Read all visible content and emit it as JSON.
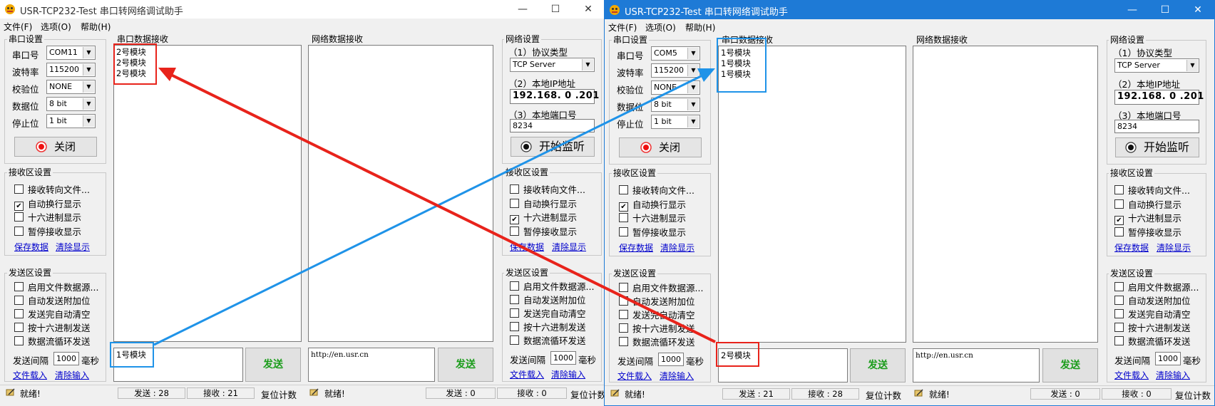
{
  "windows": [
    {
      "title": "USR-TCP232-Test 串口转网络调试助手",
      "menu": [
        "文件(F)",
        "选项(O)",
        "帮助(H)"
      ],
      "serial": {
        "legend": "串口设置",
        "port_label": "串口号",
        "port": "COM11",
        "baud_label": "波特率",
        "baud": "115200",
        "parity_label": "校验位",
        "parity": "NONE",
        "data_label": "数据位",
        "data": "8 bit",
        "stop_label": "停止位",
        "stop": "1 bit",
        "action": "关闭"
      },
      "recv_settings": {
        "legend": "接收区设置",
        "options": [
          {
            "label": "接收转向文件...",
            "checked": false
          },
          {
            "label": "自动换行显示",
            "checked": true
          },
          {
            "label": "十六进制显示",
            "checked": false
          },
          {
            "label": "暂停接收显示",
            "checked": false
          }
        ],
        "save": "保存数据",
        "clear": "清除显示"
      },
      "send_settings": {
        "legend": "发送区设置",
        "options": [
          {
            "label": "启用文件数据源...",
            "checked": false
          },
          {
            "label": "自动发送附加位",
            "checked": false
          },
          {
            "label": "发送完自动清空",
            "checked": false
          },
          {
            "label": "按十六进制发送",
            "checked": false
          },
          {
            "label": "数据流循环发送",
            "checked": false
          }
        ],
        "interval_label": "发送间隔",
        "interval": "1000",
        "interval_unit": "毫秒",
        "file_load": "文件载入",
        "clear_input": "清除输入"
      },
      "serial_recv": {
        "legend": "串口数据接收",
        "text": "2号模块\n2号模块\n2号模块"
      },
      "serial_send": {
        "text": "1号模块",
        "button": "发送"
      },
      "net_recv": {
        "legend": "网络数据接收",
        "text": ""
      },
      "net_send": {
        "text": "http://en.usr.cn",
        "button": "发送"
      },
      "net": {
        "legend": "网络设置",
        "proto_label": "（1）协议类型",
        "proto": "TCP Server",
        "ip_label": "（2）本地IP地址",
        "ip": "192.168. 0 .201",
        "port_label": "（3）本地端口号",
        "port": "8234",
        "action": "开始监听"
      },
      "net_recv_settings": {
        "legend": "接收区设置",
        "options": [
          {
            "label": "接收转向文件...",
            "checked": false
          },
          {
            "label": "自动换行显示",
            "checked": false
          },
          {
            "label": "十六进制显示",
            "checked": true
          },
          {
            "label": "暂停接收显示",
            "checked": false
          }
        ],
        "save": "保存数据",
        "clear": "清除显示"
      },
      "net_send_settings": {
        "legend": "发送区设置",
        "options": [
          {
            "label": "启用文件数据源...",
            "checked": false
          },
          {
            "label": "自动发送附加位",
            "checked": false
          },
          {
            "label": "发送完自动清空",
            "checked": false
          },
          {
            "label": "按十六进制发送",
            "checked": false
          },
          {
            "label": "数据流循环发送",
            "checked": false
          }
        ],
        "interval_label": "发送间隔",
        "interval": "1000",
        "interval_unit": "毫秒",
        "file_load": "文件载入",
        "clear_input": "清除输入"
      },
      "status": {
        "ready": "就绪!",
        "serial_sent": "发送 : 28",
        "serial_recv": "接收 : 21",
        "reset": "复位计数",
        "net_ready": "就绪!",
        "net_sent": "发送 : 0",
        "net_recv": "接收 : 0",
        "net_reset": "复位计数"
      }
    },
    {
      "title": "USR-TCP232-Test 串口转网络调试助手",
      "menu": [
        "文件(F)",
        "选项(O)",
        "帮助(H)"
      ],
      "serial": {
        "legend": "串口设置",
        "port_label": "串口号",
        "port": "COM5",
        "baud_label": "波特率",
        "baud": "115200",
        "parity_label": "校验位",
        "parity": "NONE",
        "data_label": "数据位",
        "data": "8 bit",
        "stop_label": "停止位",
        "stop": "1 bit",
        "action": "关闭"
      },
      "recv_settings": {
        "legend": "接收区设置",
        "options": [
          {
            "label": "接收转向文件...",
            "checked": false
          },
          {
            "label": "自动换行显示",
            "checked": true
          },
          {
            "label": "十六进制显示",
            "checked": false
          },
          {
            "label": "暂停接收显示",
            "checked": false
          }
        ],
        "save": "保存数据",
        "clear": "清除显示"
      },
      "send_settings": {
        "legend": "发送区设置",
        "options": [
          {
            "label": "启用文件数据源...",
            "checked": false
          },
          {
            "label": "自动发送附加位",
            "checked": false
          },
          {
            "label": "发送完自动清空",
            "checked": false
          },
          {
            "label": "按十六进制发送",
            "checked": false
          },
          {
            "label": "数据流循环发送",
            "checked": false
          }
        ],
        "interval_label": "发送间隔",
        "interval": "1000",
        "interval_unit": "毫秒",
        "file_load": "文件载入",
        "clear_input": "清除输入"
      },
      "serial_recv": {
        "legend": "串口数据接收",
        "text": "1号模块\n1号模块\n1号模块"
      },
      "serial_send": {
        "text": "2号模块",
        "button": "发送"
      },
      "net_recv": {
        "legend": "网络数据接收",
        "text": ""
      },
      "net_send": {
        "text": "http://en.usr.cn",
        "button": "发送"
      },
      "net": {
        "legend": "网络设置",
        "proto_label": "（1）协议类型",
        "proto": "TCP Server",
        "ip_label": "（2）本地IP地址",
        "ip": "192.168. 0 .201",
        "port_label": "（3）本地端口号",
        "port": "8234",
        "action": "开始监听"
      },
      "net_recv_settings": {
        "legend": "接收区设置",
        "options": [
          {
            "label": "接收转向文件...",
            "checked": false
          },
          {
            "label": "自动换行显示",
            "checked": false
          },
          {
            "label": "十六进制显示",
            "checked": true
          },
          {
            "label": "暂停接收显示",
            "checked": false
          }
        ],
        "save": "保存数据",
        "clear": "清除显示"
      },
      "net_send_settings": {
        "legend": "发送区设置",
        "options": [
          {
            "label": "启用文件数据源...",
            "checked": false
          },
          {
            "label": "自动发送附加位",
            "checked": false
          },
          {
            "label": "发送完自动清空",
            "checked": false
          },
          {
            "label": "按十六进制发送",
            "checked": false
          },
          {
            "label": "数据流循环发送",
            "checked": false
          }
        ],
        "interval_label": "发送间隔",
        "interval": "1000",
        "interval_unit": "毫秒",
        "file_load": "文件载入",
        "clear_input": "清除输入"
      },
      "status": {
        "ready": "就绪!",
        "serial_sent": "发送 : 21",
        "serial_recv": "接收 : 28",
        "reset": "复位计数",
        "net_ready": "就绪!",
        "net_sent": "发送 : 0",
        "net_recv": "接收 : 0",
        "net_reset": "复位计数"
      }
    }
  ],
  "colors": {
    "annotation_red": "#e8231b",
    "annotation_blue": "#1f93e8",
    "active_titlebar": "#1e7ad6",
    "send_text": "#1a9c1a"
  }
}
